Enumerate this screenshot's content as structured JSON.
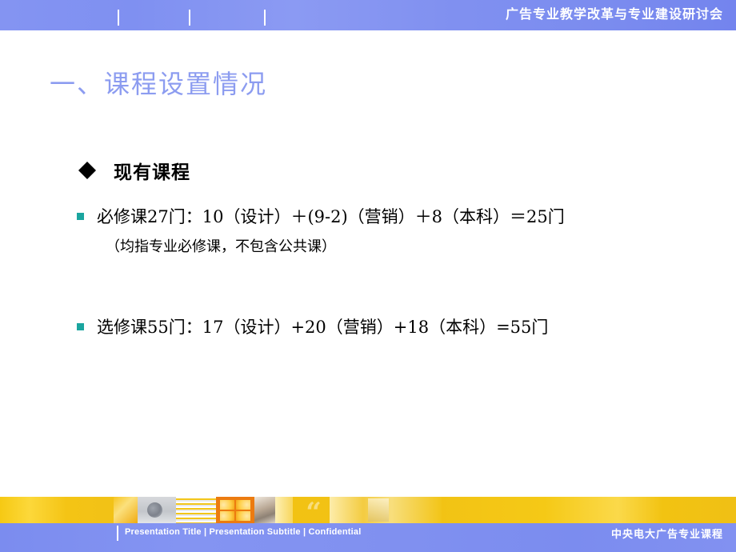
{
  "header": {
    "title": "广告专业教学改革与专业建设研讨会",
    "band_color": "#8090f0",
    "tick_count": 3
  },
  "slide": {
    "title": "一、课程设置情况",
    "title_color": "#8c9cf0"
  },
  "content": {
    "section": {
      "bullet_icon": "diamond-bullet",
      "label": "现有课程"
    },
    "items": [
      {
        "bullet_icon": "square-bullet",
        "bullet_color": "#1aa59f",
        "text": "必修课27门：10（设计）＋(9-2)（营销）＋8（本科）＝25门",
        "note": "（均指专业必修课，不包含公共课）"
      },
      {
        "bullet_icon": "square-bullet",
        "bullet_color": "#1aa59f",
        "text": "选修课55门：17（设计）+20（营销）+18（本科）=55门",
        "note": ""
      }
    ]
  },
  "footer": {
    "left_text": "Presentation Title  |  Presentation Subtitle  |  Confidential",
    "right_text": "中央电大广告专业课程",
    "yellow_band_color": "#f2c313",
    "blue_band_color": "#8090f0",
    "quote_glyph": "“"
  }
}
